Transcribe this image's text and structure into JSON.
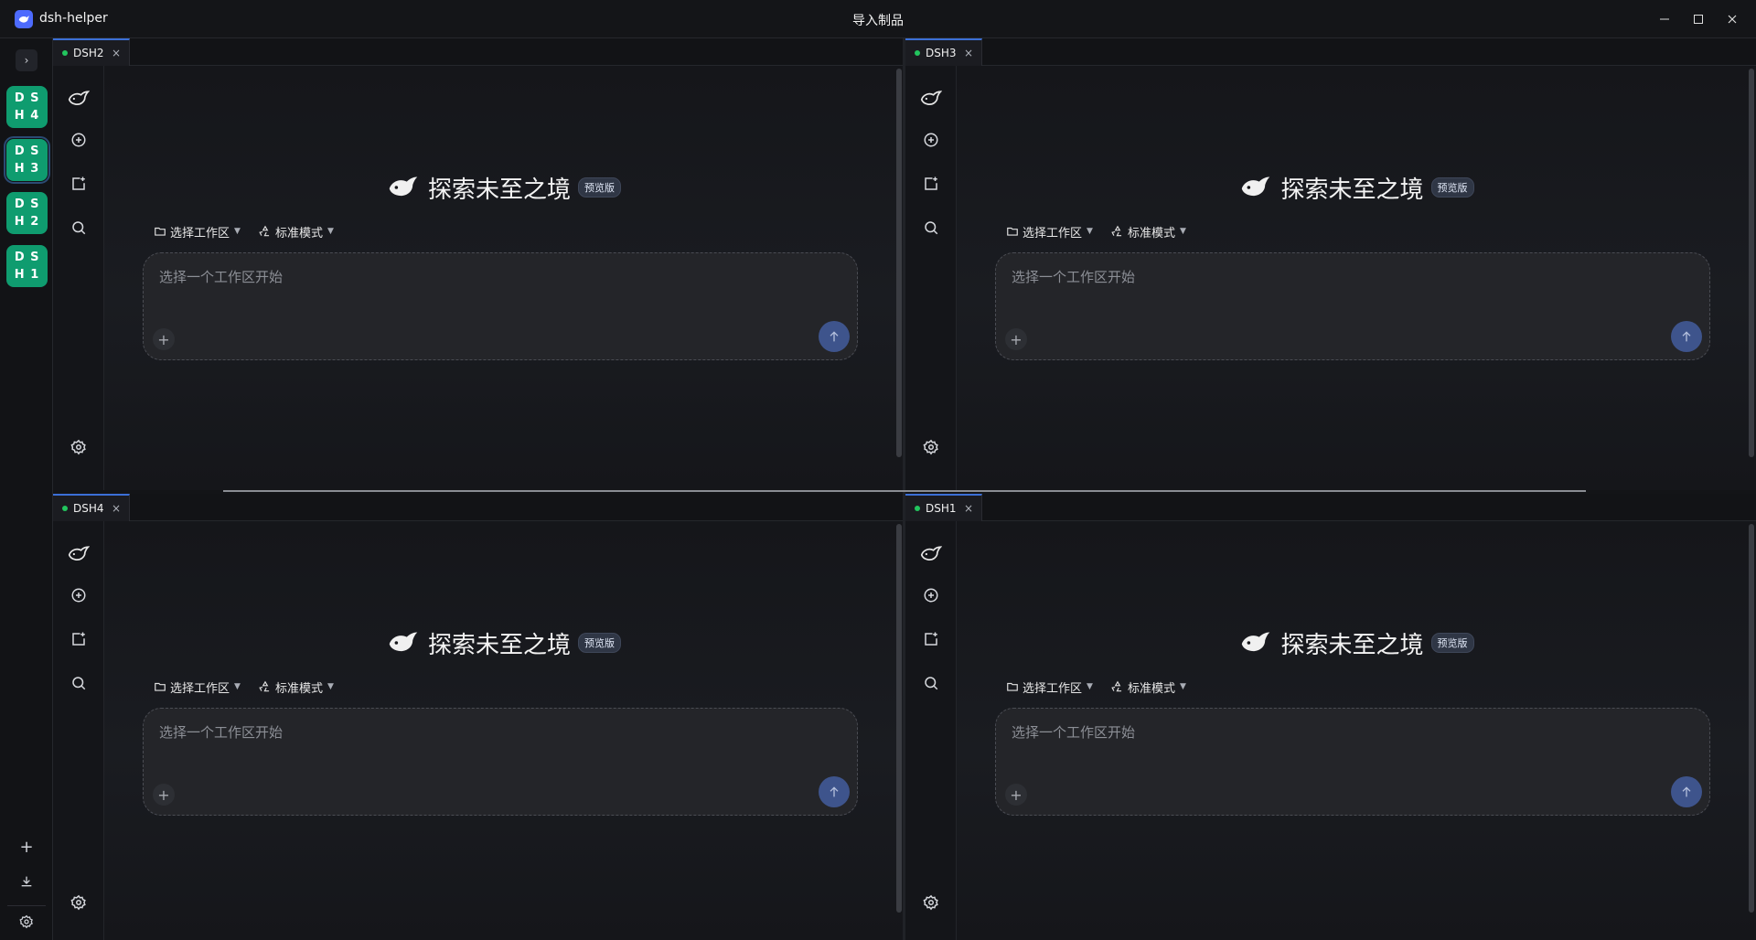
{
  "app": {
    "name": "dsh-helper",
    "window_title": "导入制品"
  },
  "window_controls": {
    "minimize": "—",
    "maximize": "☐",
    "close": "✕"
  },
  "sidebar": {
    "expand_glyph": "›",
    "instances": [
      {
        "chars": [
          "D",
          "S",
          "H",
          "4"
        ],
        "active": false
      },
      {
        "chars": [
          "D",
          "S",
          "H",
          "3"
        ],
        "active": true
      },
      {
        "chars": [
          "D",
          "S",
          "H",
          "2"
        ],
        "active": false
      },
      {
        "chars": [
          "D",
          "S",
          "H",
          "1"
        ],
        "active": false
      }
    ],
    "add_glyph": "+"
  },
  "panes": [
    {
      "tab": "DSH2",
      "close": "×",
      "welcome": "探索未至之境",
      "badge": "预览版",
      "workspace": "选择工作区",
      "mode": "标准模式",
      "placeholder": "选择一个工作区开始",
      "plus": "+"
    },
    {
      "tab": "DSH3",
      "close": "×",
      "welcome": "探索未至之境",
      "badge": "预览版",
      "workspace": "选择工作区",
      "mode": "标准模式",
      "placeholder": "选择一个工作区开始",
      "plus": "+"
    },
    {
      "tab": "DSH4",
      "close": "×",
      "welcome": "探索未至之境",
      "badge": "预览版",
      "workspace": "选择工作区",
      "mode": "标准模式",
      "placeholder": "选择一个工作区开始",
      "plus": "+"
    },
    {
      "tab": "DSH1",
      "close": "×",
      "welcome": "探索未至之境",
      "badge": "预览版",
      "workspace": "选择工作区",
      "mode": "标准模式",
      "placeholder": "选择一个工作区开始",
      "plus": "+"
    }
  ],
  "colors": {
    "instance_green": "#0f9c6f",
    "accent_blue": "#3b6fd6",
    "send_blue": "#3e548c",
    "status_dot": "#22c55e"
  },
  "icons": [
    "whale-icon",
    "plus-circle-icon",
    "add-folder-icon",
    "search-icon",
    "gear-icon",
    "folder-icon",
    "recycle-icon",
    "arrow-up-icon",
    "download-icon"
  ]
}
